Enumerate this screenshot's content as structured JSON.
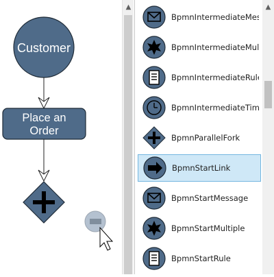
{
  "canvas": {
    "customer_label": "Customer",
    "order_label_line1": "Place an",
    "order_label_line2": "Order",
    "shape_fill": "#4f6b89",
    "shape_stroke": "#1e2a36"
  },
  "palette": {
    "items": [
      {
        "label": "BpmnIntermediateMessage",
        "icon": "envelope-icon"
      },
      {
        "label": "BpmnIntermediateMultiple",
        "icon": "star-icon"
      },
      {
        "label": "BpmnIntermediateRule",
        "icon": "document-icon"
      },
      {
        "label": "BpmnIntermediateTimer",
        "icon": "clock-icon"
      },
      {
        "label": "BpmnParallelFork",
        "icon": "plus-diamond-icon"
      },
      {
        "label": "BpmnStartLink",
        "icon": "arrow-right-icon"
      },
      {
        "label": "BpmnStartMessage",
        "icon": "envelope-icon"
      },
      {
        "label": "BpmnStartMultiple",
        "icon": "star-icon"
      },
      {
        "label": "BpmnStartRule",
        "icon": "document-icon"
      }
    ],
    "selected_index": 5
  },
  "colors": {
    "selected_bg": "#cfe8f7",
    "selected_border": "#74b6e0"
  }
}
